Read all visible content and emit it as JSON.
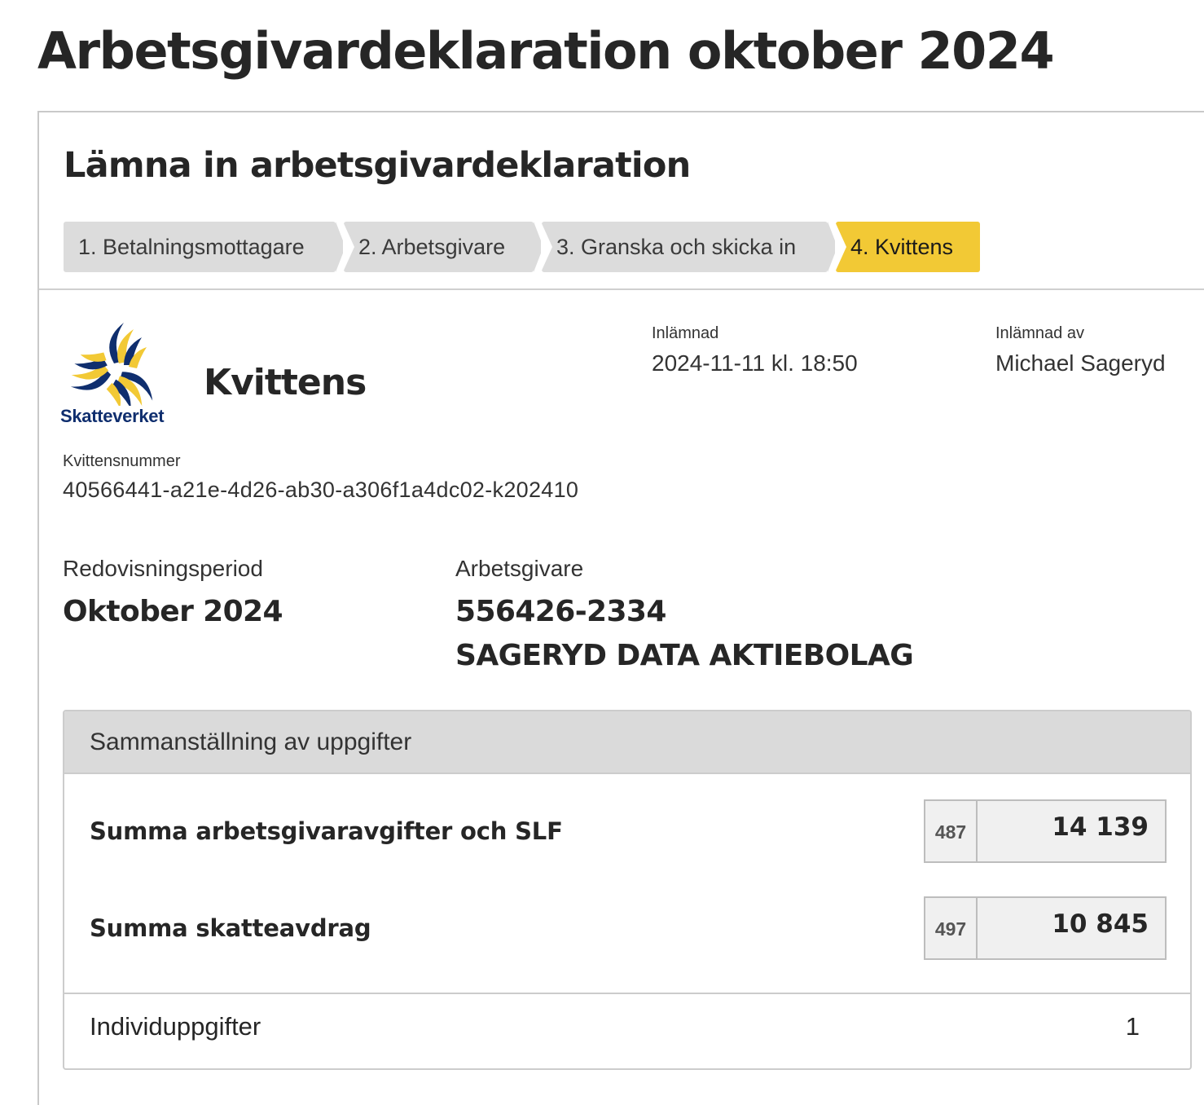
{
  "page": {
    "title": "Arbetsgivardeklaration oktober 2024"
  },
  "card": {
    "title": "Lämna in arbetsgivardeklaration"
  },
  "steps": [
    {
      "label": "1. Betalningsmottagare",
      "active": false
    },
    {
      "label": "2. Arbetsgivare",
      "active": false
    },
    {
      "label": "3. Granska och skicka in",
      "active": false
    },
    {
      "label": "4. Kvittens",
      "active": true
    }
  ],
  "receipt": {
    "logo_text": "Skatteverket",
    "title": "Kvittens",
    "submitted_label": "Inlämnad",
    "submitted_value": "2024-11-11 kl. 18:50",
    "submitted_by_label": "Inlämnad av",
    "submitted_by_value": "Michael Sageryd",
    "number_label": "Kvittensnummer",
    "number_value": "40566441-a21e-4d26-ab30-a306f1a4dc02-k202410"
  },
  "period": {
    "label": "Redovisningsperiod",
    "value": "Oktober 2024"
  },
  "employer": {
    "label": "Arbetsgivare",
    "org_no": "556426-2334",
    "name": "SAGERYD DATA AKTIEBOLAG"
  },
  "summary": {
    "heading": "Sammanställning av uppgifter",
    "rows": [
      {
        "label": "Summa arbetsgivaravgifter och SLF",
        "code": "487",
        "value": "14 139"
      },
      {
        "label": "Summa skatteavdrag",
        "code": "497",
        "value": "10 845"
      }
    ],
    "footer": {
      "label": "Individuppgifter",
      "value": "1"
    }
  },
  "colors": {
    "active_step": "#f2c935",
    "inactive_step": "#dcdcdc",
    "logo_blue": "#0f2e6e",
    "logo_yellow": "#f2c935"
  }
}
